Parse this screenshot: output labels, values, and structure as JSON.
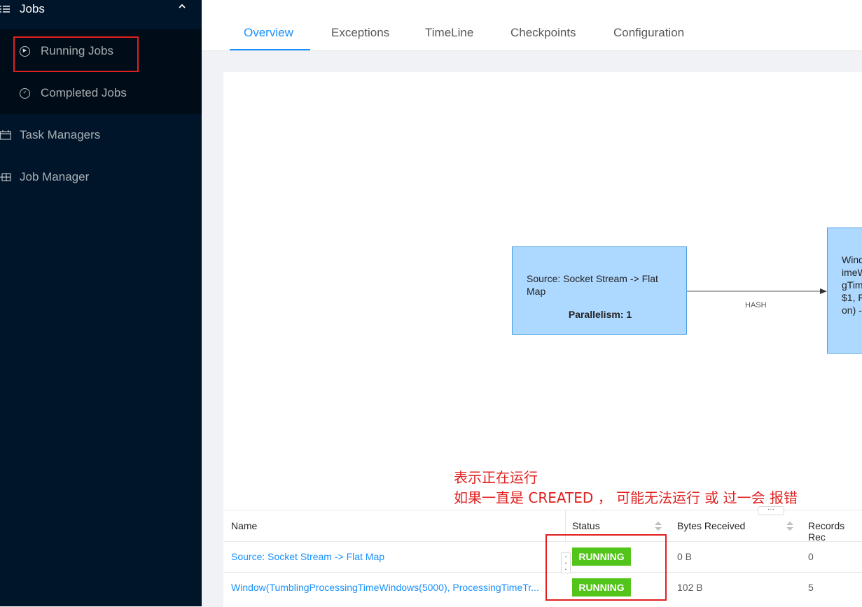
{
  "sidebar": {
    "group": {
      "label": "Jobs",
      "icon": "list-icon",
      "chevron": "chevron-up-icon"
    },
    "subitems": [
      {
        "label": "Running Jobs",
        "icon": "play-circle-icon"
      },
      {
        "label": "Completed Jobs",
        "icon": "check-circle-icon"
      }
    ],
    "items": [
      {
        "label": "Task Managers",
        "icon": "calendar-icon"
      },
      {
        "label": "Job Manager",
        "icon": "grid-icon"
      }
    ]
  },
  "tabs": [
    {
      "label": "Overview",
      "active": true
    },
    {
      "label": "Exceptions"
    },
    {
      "label": "TimeLine"
    },
    {
      "label": "Checkpoints"
    },
    {
      "label": "Configuration"
    }
  ],
  "graph": {
    "source_node": {
      "title": "Source: Socket Stream -> Flat Map",
      "parallelism": "Parallelism: 1"
    },
    "edge_label": "HASH",
    "window_node_fragment": [
      "Wind",
      "imeW",
      "gTim",
      "$1, F",
      "on) -"
    ]
  },
  "annotation": {
    "line1": "表示正在运行",
    "line2": "如果一直是 CREATED ， 可能无法运行 或 过一会 报错"
  },
  "table": {
    "resize_handle": "···",
    "columns": [
      "Name",
      "Status",
      "Bytes Received",
      "Records Rec"
    ],
    "rows": [
      {
        "name": "Source: Socket Stream -> Flat Map",
        "status": "RUNNING",
        "bytes": "0 B",
        "records": "0"
      },
      {
        "name": "Window(TumblingProcessingTimeWindows(5000), ProcessingTimeTr...",
        "status": "RUNNING",
        "bytes": "102 B",
        "records": "5"
      }
    ]
  },
  "colors": {
    "sidebar_bg": "#001529",
    "accent": "#1890ff",
    "running": "#52c41a",
    "annotation": "#e02020",
    "node_fill": "#add8ff"
  }
}
